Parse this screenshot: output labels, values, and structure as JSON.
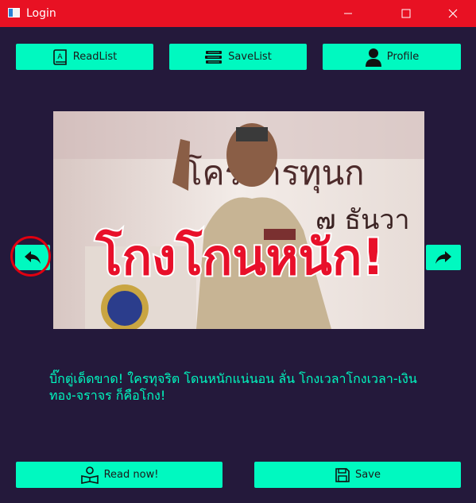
{
  "window": {
    "title": "Login"
  },
  "toolbar": {
    "readlist_label": "ReadList",
    "savelist_label": "SaveList",
    "profile_label": "Profile"
  },
  "news": {
    "headline_overlay": "โกงโกนหนัก!",
    "backdrop_text_1": "โครการทุนก",
    "backdrop_text_2": "๗ ธันวา",
    "caption": "บิ๊กตู่เด็ดขาด! ใครทุจริต โดนหนักแน่นอน ลั่น โกงเวลาโกงเวลา-เงินทอง-จราจร ก็คือโกง!"
  },
  "footer": {
    "read_now_label": "Read now!",
    "save_label": "Save"
  },
  "colors": {
    "accent": "#00f9c0",
    "background": "#24193b",
    "titlebar": "#e81123",
    "highlight": "#e00010"
  },
  "icons": [
    "book-icon",
    "books-stack-icon",
    "user-icon",
    "reply-back-icon",
    "share-forward-icon",
    "reader-icon",
    "floppy-save-icon"
  ]
}
